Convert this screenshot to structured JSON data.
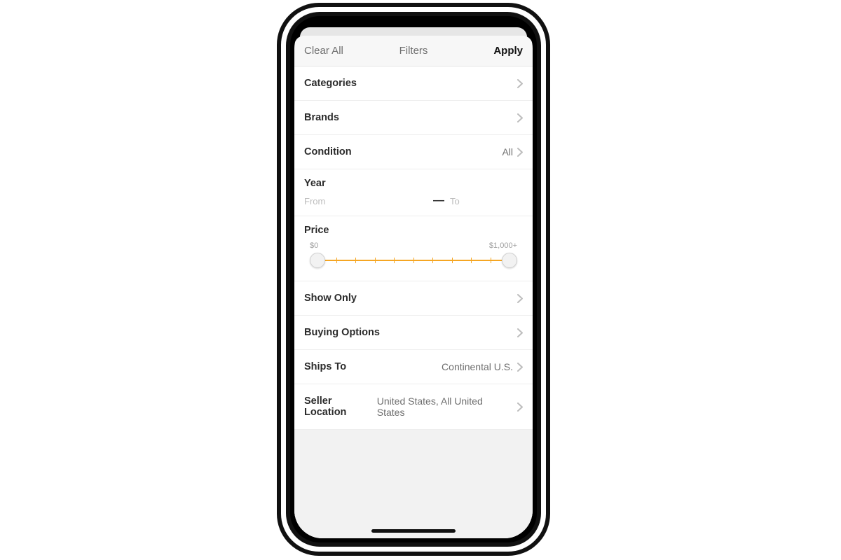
{
  "header": {
    "clear_all": "Clear All",
    "title": "Filters",
    "apply": "Apply"
  },
  "rows": {
    "categories": {
      "label": "Categories"
    },
    "brands": {
      "label": "Brands"
    },
    "condition": {
      "label": "Condition",
      "value": "All"
    },
    "year": {
      "label": "Year",
      "from_placeholder": "From",
      "to_placeholder": "To",
      "dash": "—"
    },
    "price": {
      "label": "Price",
      "min_label": "$0",
      "max_label": "$1,000+"
    },
    "show_only": {
      "label": "Show Only"
    },
    "buying_options": {
      "label": "Buying Options"
    },
    "ships_to": {
      "label": "Ships To",
      "value": "Continental U.S."
    },
    "seller_location": {
      "label": "Seller Location",
      "value": "United States, All United States"
    }
  }
}
